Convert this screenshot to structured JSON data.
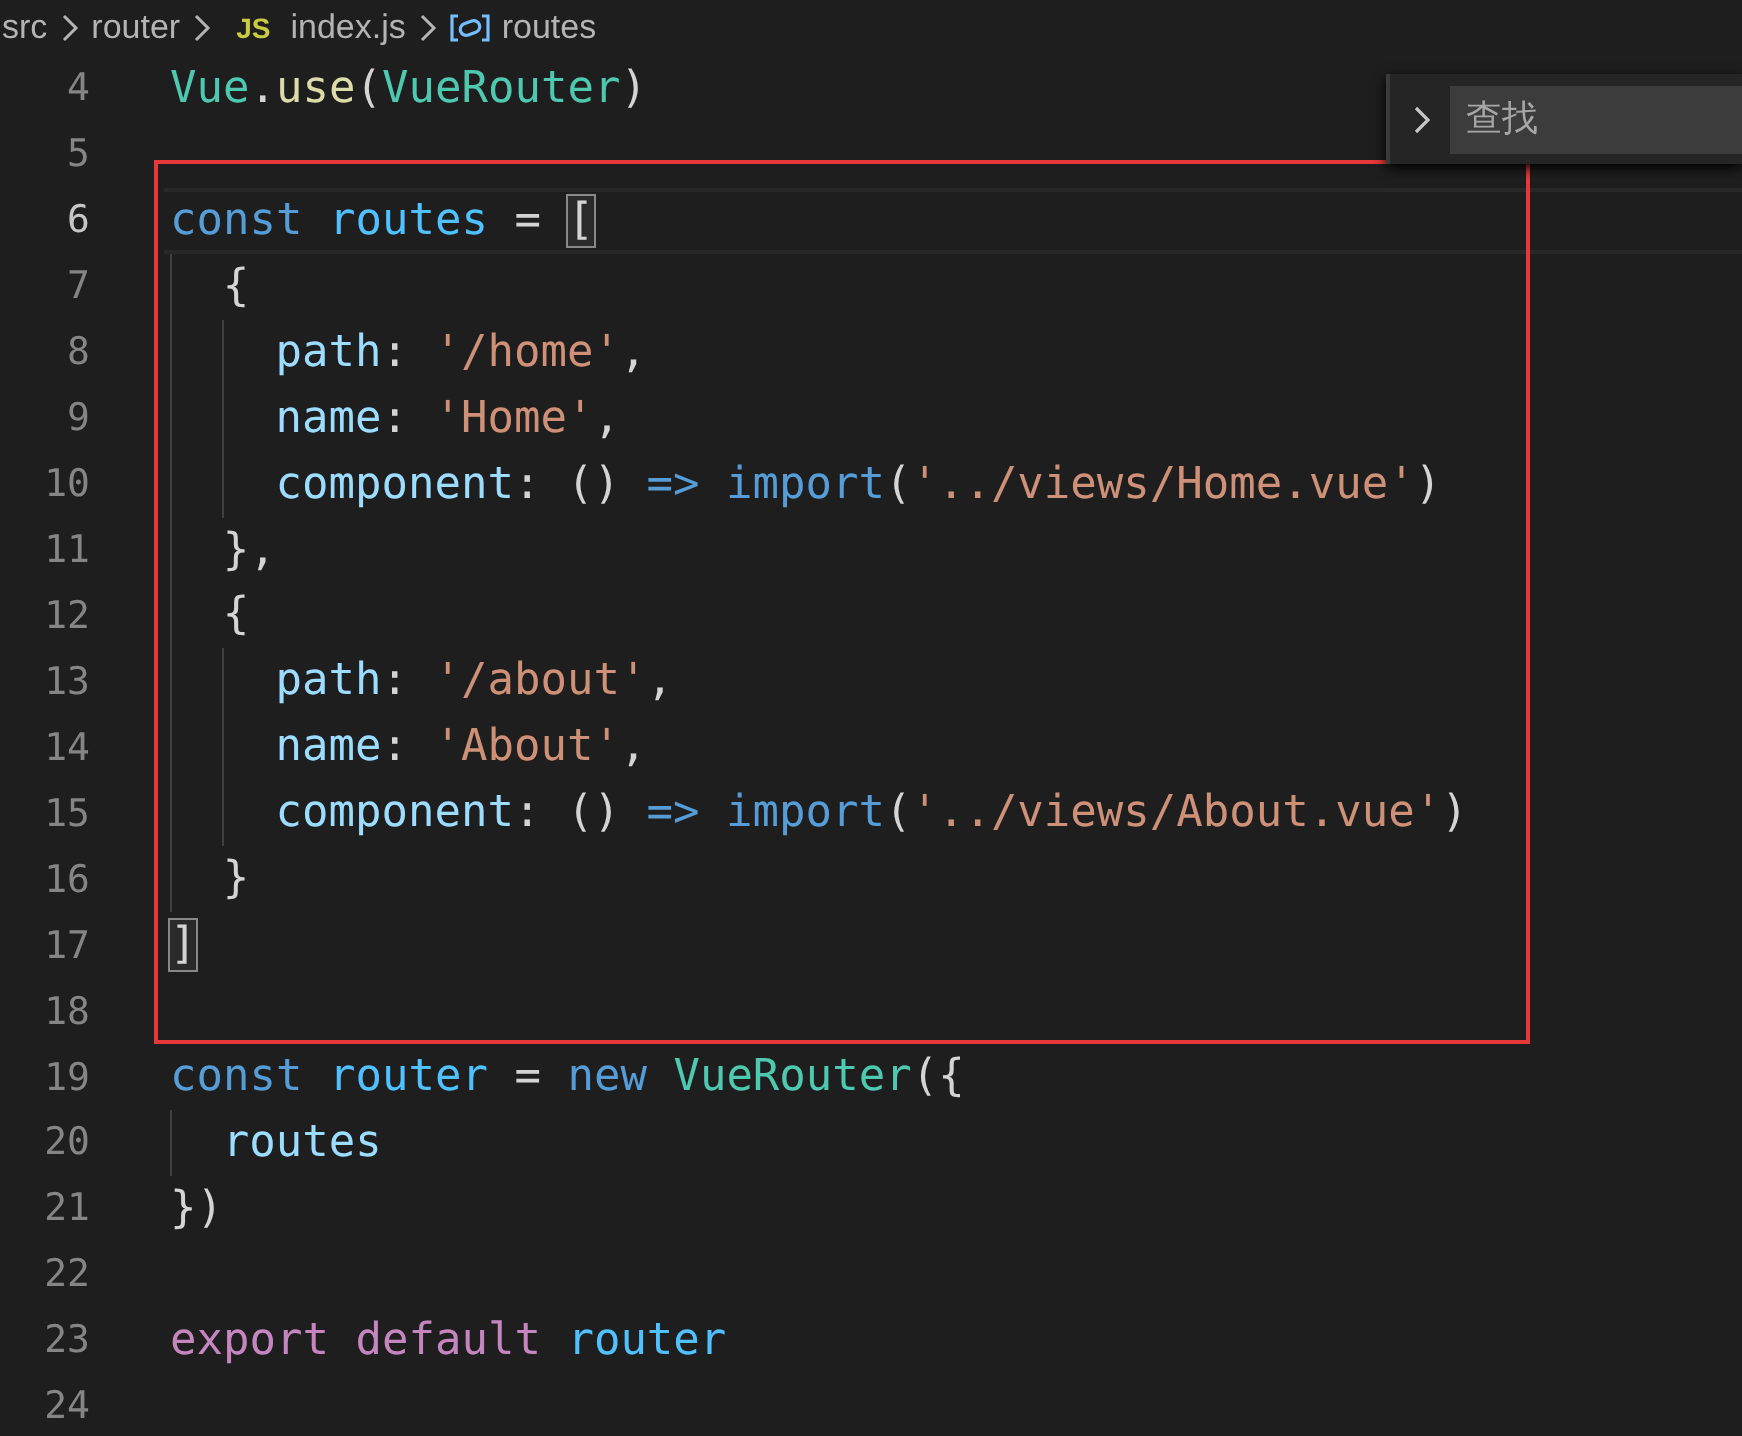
{
  "breadcrumb": [
    {
      "kind": "folder",
      "text": "src"
    },
    {
      "kind": "folder",
      "text": "router"
    },
    {
      "kind": "js-file",
      "badge": "JS",
      "text": "index.js"
    },
    {
      "kind": "symbol",
      "text": "routes"
    }
  ],
  "find_widget": {
    "placeholder": "查找"
  },
  "editor": {
    "sections": [
      {
        "kind": "plain",
        "lines": [
          {
            "number": "4",
            "current": false,
            "tokens": [
              {
                "kind": "class",
                "text": "Vue"
              },
              {
                "kind": "plain",
                "text": "."
              },
              {
                "kind": "func",
                "text": "use"
              },
              {
                "kind": "plain",
                "text": "("
              },
              {
                "kind": "class",
                "text": "VueRouter"
              },
              {
                "kind": "plain",
                "text": ")"
              }
            ]
          },
          {
            "number": "5",
            "current": false
          }
        ]
      },
      {
        "kind": "highlight-box",
        "lines": [
          {
            "number": "6",
            "current": true,
            "tokens": [
              {
                "kind": "keyword",
                "text": "const"
              },
              {
                "kind": "const",
                "text": " routes"
              },
              {
                "kind": "plain",
                "text": " = "
              },
              {
                "kind": "bracket-match",
                "text": "["
              }
            ]
          },
          {
            "number": "7",
            "current": false,
            "tokens": [
              {
                "kind": "plain",
                "text": "  {"
              }
            ]
          },
          {
            "number": "8",
            "current": false,
            "tokens": [
              {
                "kind": "prop",
                "text": "    path"
              },
              {
                "kind": "plain",
                "text": ": "
              },
              {
                "kind": "string",
                "text": "'/home'"
              },
              {
                "kind": "plain",
                "text": ","
              }
            ]
          },
          {
            "number": "9",
            "current": false,
            "tokens": [
              {
                "kind": "prop",
                "text": "    name"
              },
              {
                "kind": "plain",
                "text": ": "
              },
              {
                "kind": "string",
                "text": "'Home'"
              },
              {
                "kind": "plain",
                "text": ","
              }
            ]
          },
          {
            "number": "10",
            "current": false,
            "tokens": [
              {
                "kind": "prop",
                "text": "    component"
              },
              {
                "kind": "plain",
                "text": ": () "
              },
              {
                "kind": "keyword",
                "text": "=>"
              },
              {
                "kind": "keyword",
                "text": " import"
              },
              {
                "kind": "plain",
                "text": "("
              },
              {
                "kind": "string",
                "text": "'../views/Home.vue'"
              },
              {
                "kind": "plain",
                "text": ")"
              }
            ]
          },
          {
            "number": "11",
            "current": false,
            "tokens": [
              {
                "kind": "plain",
                "text": "  },"
              }
            ]
          },
          {
            "number": "12",
            "current": false,
            "tokens": [
              {
                "kind": "plain",
                "text": "  {"
              }
            ]
          },
          {
            "number": "13",
            "current": false,
            "tokens": [
              {
                "kind": "prop",
                "text": "    path"
              },
              {
                "kind": "plain",
                "text": ": "
              },
              {
                "kind": "string",
                "text": "'/about'"
              },
              {
                "kind": "plain",
                "text": ","
              }
            ]
          },
          {
            "number": "14",
            "current": false,
            "tokens": [
              {
                "kind": "prop",
                "text": "    name"
              },
              {
                "kind": "plain",
                "text": ": "
              },
              {
                "kind": "string",
                "text": "'About'"
              },
              {
                "kind": "plain",
                "text": ","
              }
            ]
          },
          {
            "number": "15",
            "current": false,
            "tokens": [
              {
                "kind": "prop",
                "text": "    component"
              },
              {
                "kind": "plain",
                "text": ": () "
              },
              {
                "kind": "keyword",
                "text": "=>"
              },
              {
                "kind": "keyword",
                "text": " import"
              },
              {
                "kind": "plain",
                "text": "("
              },
              {
                "kind": "string",
                "text": "'../views/About.vue'"
              },
              {
                "kind": "plain",
                "text": ")"
              }
            ]
          },
          {
            "number": "16",
            "current": false,
            "tokens": [
              {
                "kind": "plain",
                "text": "  }"
              }
            ]
          },
          {
            "number": "17",
            "current": false,
            "tokens": [
              {
                "kind": "bracket-match",
                "text": "]"
              }
            ]
          },
          {
            "number": "18",
            "current": false
          }
        ]
      },
      {
        "kind": "plain",
        "lines": [
          {
            "number": "19",
            "current": false,
            "tokens": [
              {
                "kind": "keyword",
                "text": "const"
              },
              {
                "kind": "const",
                "text": " router"
              },
              {
                "kind": "plain",
                "text": " = "
              },
              {
                "kind": "keyword",
                "text": "new"
              },
              {
                "kind": "class",
                "text": " VueRouter"
              },
              {
                "kind": "plain",
                "text": "({"
              }
            ]
          },
          {
            "number": "20",
            "current": false,
            "tokens": [
              {
                "kind": "prop",
                "text": "  routes"
              }
            ]
          },
          {
            "number": "21",
            "current": false,
            "tokens": [
              {
                "kind": "plain",
                "text": "})"
              }
            ]
          },
          {
            "number": "22",
            "current": false
          },
          {
            "number": "23",
            "current": false,
            "tokens": [
              {
                "kind": "control",
                "text": "export"
              },
              {
                "kind": "control",
                "text": " default"
              },
              {
                "kind": "const",
                "text": " router"
              }
            ]
          },
          {
            "number": "24",
            "current": false
          }
        ]
      }
    ]
  }
}
